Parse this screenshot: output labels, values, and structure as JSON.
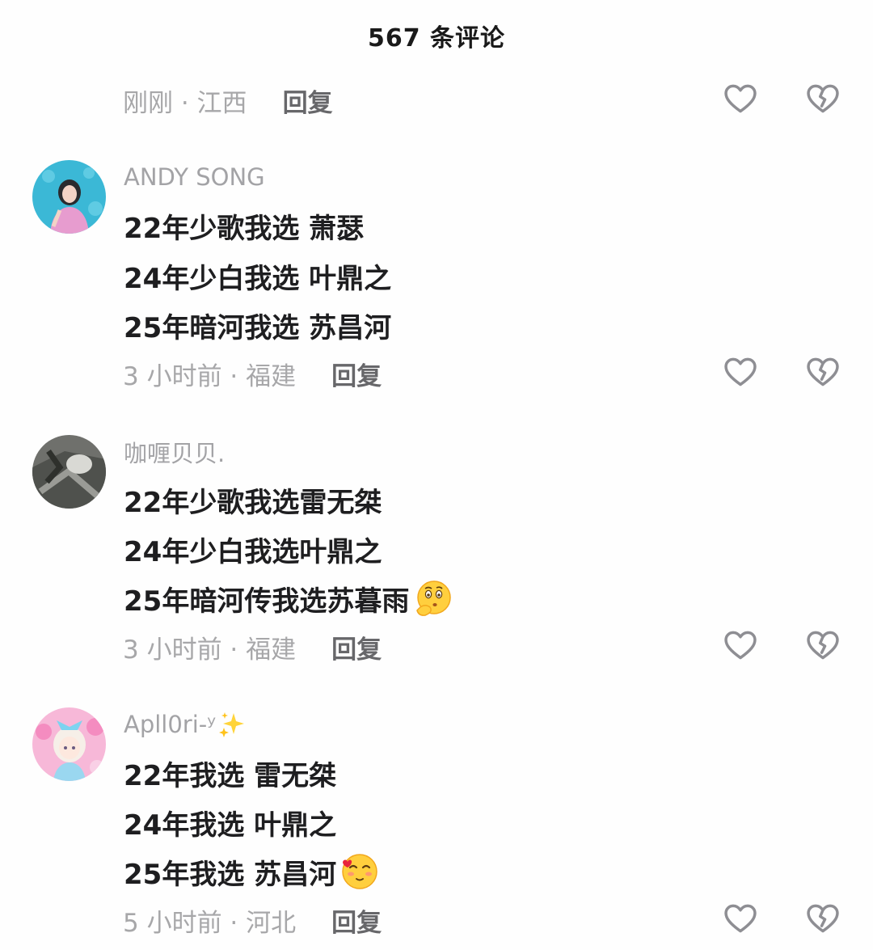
{
  "header": {
    "title": "567 条评论"
  },
  "comments": [
    {
      "meta": "刚刚 · 江西",
      "reply_label": "回复",
      "like_icon": "heart-outline-icon",
      "dislike_icon": "broken-heart-icon"
    },
    {
      "username": "ANDY SONG",
      "lines": [
        "22年少歌我选 萧瑟",
        "24年少白我选 叶鼎之",
        "25年暗河我选 苏昌河"
      ],
      "meta": "3 小时前 · 福建",
      "reply_label": "回复"
    },
    {
      "username": "咖喱贝贝.",
      "lines": [
        "22年少歌我选雷无桀",
        "24年少白我选叶鼎之",
        "25年暗河传我选苏暮雨"
      ],
      "emoji": "thinking-face-icon",
      "meta": "3 小时前 · 福建",
      "reply_label": "回复"
    },
    {
      "username": "Apll0ri-ʸ",
      "username_emoji": "sparkles-icon",
      "lines": [
        "22年我选  雷无桀",
        "24年我选  叶鼎之",
        "25年我选  苏昌河"
      ],
      "emoji": "blush-kiss-face-icon",
      "meta": "5 小时前 · 河北",
      "reply_label": "回复"
    }
  ],
  "colors": {
    "meta_text": "#a7a7a9",
    "reply_text": "#67676a",
    "body_text": "#1e1e20",
    "icon_stroke": "#8e8e93"
  }
}
